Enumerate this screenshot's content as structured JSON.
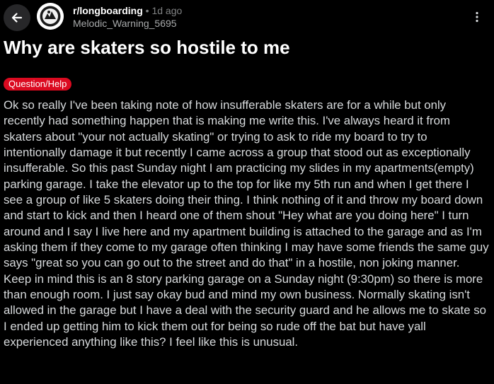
{
  "header": {
    "subreddit": "r/longboarding",
    "separator": "•",
    "age": "1d ago",
    "author": "Melodic_Warning_5695",
    "back_icon": "back-arrow-icon",
    "more_icon": "more-dots-icon"
  },
  "post": {
    "title": "Why are skaters so hostile to me",
    "flair": "Question/Help",
    "body": "Ok so really I've been taking note of how insufferable skaters are for a while but only recently had something happen that is making me write this. I've always heard it from skaters about \"your not actually skating\" or trying to ask to ride my board to try to intentionally damage it but recently I came across a group that stood out as exceptionally insufferable. So this past Sunday night I am practicing my slides in my apartments(empty) parking garage. I take the elevator up to the top for like my 5th run and when I get there I see a group of like 5 skaters doing their thing. I think nothing of it and throw my board down and start to kick and then I heard one of them shout \"Hey what are you doing here\" I turn around and I say I live here and my apartment building is attached to the garage and as I'm asking them if they come to my garage often thinking I may have some friends the same guy says \"great so you can go out to the street and do that\" in a hostile, non joking manner. Keep in mind this is an 8 story parking garage on a Sunday night (9:30pm) so there is more than enough room. I just say okay bud and mind my own business. Normally skating isn't allowed in the garage but I have a deal with the security guard and he allows me to skate so I ended up getting him to kick them out for being so rude off the bat but have yall experienced anything like this? I feel like this is unusual."
  },
  "colors": {
    "background": "#000000",
    "flair_bg": "#db0a20",
    "back_button_bg": "#272729",
    "text": "#d7dadc",
    "muted": "#818384"
  }
}
